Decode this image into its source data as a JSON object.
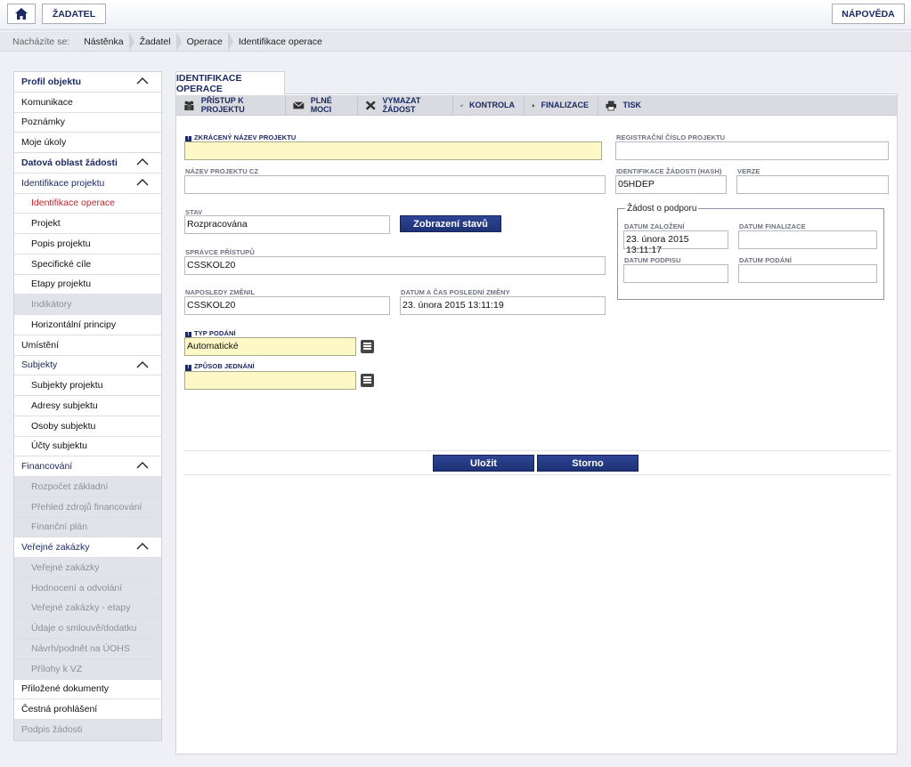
{
  "topbar": {
    "home_icon": "home-icon",
    "zadatel_label": "ŽADATEL",
    "napoveda_label": "NÁPOVĚDA"
  },
  "breadcrumb": {
    "lead": "Nacházíte se:",
    "items": [
      "Nástěnka",
      "Žadatel",
      "Operace",
      "Identifikace operace"
    ]
  },
  "sidebar": {
    "items": [
      {
        "label": "Profil objektu",
        "kind": "head",
        "chevron": true
      },
      {
        "label": "Komunikace",
        "kind": "nav"
      },
      {
        "label": "Poznámky",
        "kind": "nav"
      },
      {
        "label": "Moje úkoly",
        "kind": "nav"
      },
      {
        "label": "Datová oblast žádosti",
        "kind": "head",
        "chevron": true
      },
      {
        "label": "Identifikace projektu",
        "kind": "group",
        "chevron": true
      },
      {
        "label": "Identifikace operace",
        "kind": "active"
      },
      {
        "label": "Projekt",
        "kind": "sub"
      },
      {
        "label": "Popis projektu",
        "kind": "sub"
      },
      {
        "label": "Specifické cíle",
        "kind": "sub"
      },
      {
        "label": "Etapy projektu",
        "kind": "sub"
      },
      {
        "label": "Indikátory",
        "kind": "subdis"
      },
      {
        "label": "Horizontální principy",
        "kind": "sub"
      },
      {
        "label": "Umístění",
        "kind": "nav"
      },
      {
        "label": "Subjekty",
        "kind": "group",
        "chevron": true
      },
      {
        "label": "Subjekty projektu",
        "kind": "sub"
      },
      {
        "label": "Adresy subjektu",
        "kind": "sub"
      },
      {
        "label": "Osoby subjektu",
        "kind": "sub"
      },
      {
        "label": "Účty subjektu",
        "kind": "sub"
      },
      {
        "label": "Financování",
        "kind": "group",
        "chevron": true
      },
      {
        "label": "Rozpočet základní",
        "kind": "subdis"
      },
      {
        "label": "Přehled zdrojů financování",
        "kind": "subdis"
      },
      {
        "label": "Finanční plán",
        "kind": "subdis"
      },
      {
        "label": "Veřejné zakázky",
        "kind": "group",
        "chevron": true
      },
      {
        "label": "Veřejné zakázky",
        "kind": "subdis"
      },
      {
        "label": "Hodnocení a odvolání",
        "kind": "subdis"
      },
      {
        "label": "Veřejné zakázky - etapy",
        "kind": "subdis"
      },
      {
        "label": "Údaje o smlouvě/dodatku",
        "kind": "subdis"
      },
      {
        "label": "Návrh/podnět na ÚOHS",
        "kind": "subdis"
      },
      {
        "label": "Přílohy k VZ",
        "kind": "subdis"
      },
      {
        "label": "Přiložené dokumenty",
        "kind": "nav"
      },
      {
        "label": "Čestná prohlášení",
        "kind": "nav"
      },
      {
        "label": "Podpis žádosti",
        "kind": "navdis"
      }
    ]
  },
  "tab": {
    "title": "IDENTIFIKACE OPERACE"
  },
  "toolbar": {
    "items": [
      {
        "label": "PŘÍSTUP K PROJEKTU",
        "icon": "users-icon"
      },
      {
        "label": "PLNÉ MOCI",
        "icon": "envelope-icon"
      },
      {
        "label": "VYMAZAT ŽÁDOST",
        "icon": "delete-icon"
      },
      {
        "label": "KONTROLA",
        "icon": "check-icon"
      },
      {
        "label": "FINALIZACE",
        "icon": "lock-icon"
      },
      {
        "label": "TISK",
        "icon": "printer-icon"
      }
    ]
  },
  "form": {
    "zkraceny_nazev": {
      "label": "ZKRÁCENÝ NÁZEV PROJEKTU",
      "value": ""
    },
    "nazev_cz": {
      "label": "NÁZEV PROJEKTU CZ",
      "value": ""
    },
    "stav": {
      "label": "STAV",
      "value": "Rozpracována"
    },
    "zobrazeni_stavu": "Zobrazení stavů",
    "spravce": {
      "label": "SPRÁVCE PŘÍSTUPŮ",
      "value": "CSSKOL20"
    },
    "naposledy": {
      "label": "NAPOSLEDY ZMĚNIL",
      "value": "CSSKOL20"
    },
    "datum_zmeny": {
      "label": "DATUM A ČAS POSLEDNÍ ZMĚNY",
      "value": "23. února 2015 13:11:19"
    },
    "typ_podani": {
      "label": "TYP PODÁNÍ",
      "value": "Automatické"
    },
    "zpusob_jednani": {
      "label": "ZPŮSOB JEDNÁNÍ",
      "value": ""
    },
    "reg_cislo": {
      "label": "REGISTRAČNÍ ČÍSLO PROJEKTU",
      "value": ""
    },
    "hash": {
      "label": "IDENTIFIKACE ŽÁDOSTI (HASH)",
      "value": "05HDEP"
    },
    "verze": {
      "label": "VERZE",
      "value": ""
    },
    "zadost_legend": "Žádost o podporu",
    "datum_zalozeni": {
      "label": "DATUM ZALOŽENÍ",
      "value": "23. února 2015 13:11:17"
    },
    "datum_finalizace": {
      "label": "DATUM FINALIZACE",
      "value": ""
    },
    "datum_podpisu": {
      "label": "DATUM PODPISU",
      "value": ""
    },
    "datum_podani": {
      "label": "DATUM PODÁNÍ",
      "value": ""
    },
    "save_label": "Uložit",
    "cancel_label": "Storno"
  },
  "colors": {
    "brand_navy": "#1b2a63",
    "required_field": "#fdf8c5",
    "active_item": "#c0272d"
  }
}
